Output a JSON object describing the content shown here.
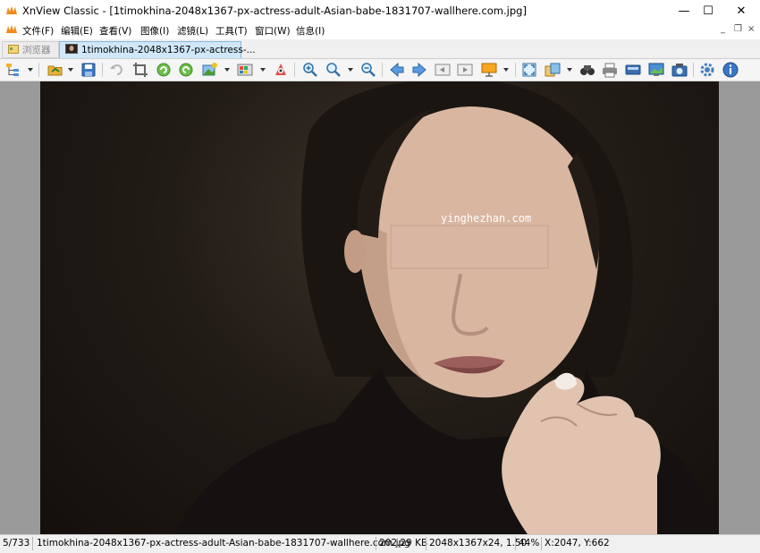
{
  "window": {
    "title": "XnView Classic - [1timokhina-2048x1367-px-actress-adult-Asian-babe-1831707-wallhere.com.jpg]",
    "controls": {
      "minimize": "—",
      "maximize": "☐",
      "close": "✕"
    }
  },
  "menu": {
    "items": [
      "文件(F)",
      "编辑(E)",
      "查看(V)",
      "图像(I)",
      "滤镜(L)",
      "工具(T)",
      "窗口(W)",
      "信息(I)"
    ],
    "mdi_controls": {
      "minimize": "_",
      "restore": "❐",
      "close": "×"
    }
  },
  "tabs": [
    {
      "label": "浏览器",
      "active": false
    },
    {
      "label": "1timokhina-2048x1367-px-actress-...",
      "active": true
    }
  ],
  "toolbar": {
    "buttons": [
      "tree-view-icon",
      "open-folder-icon",
      "save-icon",
      "undo-icon",
      "crop-icon",
      "rotate-left-icon",
      "rotate-right-icon",
      "adjust-icon",
      "color-palette-icon",
      "red-eye-icon",
      "zoom-in-icon",
      "zoom-icon",
      "zoom-out-icon",
      "previous-icon",
      "next-icon",
      "first-image-icon",
      "last-image-icon",
      "slideshow-icon",
      "fullscreen-icon",
      "compare-icon",
      "find-icon",
      "print-icon",
      "scan-icon",
      "set-wallpaper-icon",
      "capture-icon",
      "settings-icon",
      "info-icon"
    ]
  },
  "image": {
    "watermark": "yinghezhan.com",
    "colors": {
      "background": "#1a1411",
      "skin": "#d9b6a0",
      "hair": "#1b1512",
      "lips": "#9c5f5c"
    }
  },
  "status": {
    "index": "5/733",
    "filename": "1timokhina-2048x1367-px-actress-adult-Asian-babe-1831707-wallhere.com.jpg",
    "filesize": "202.29 KB",
    "dimensions": "2048x1367x24, 1.50",
    "zoom": "44%",
    "coords": "X:2047, Y:662"
  },
  "colors": {
    "accent": "#0078d7",
    "active_tab": "#cfe7f8",
    "viewer_bg": "#9a9a9a"
  }
}
